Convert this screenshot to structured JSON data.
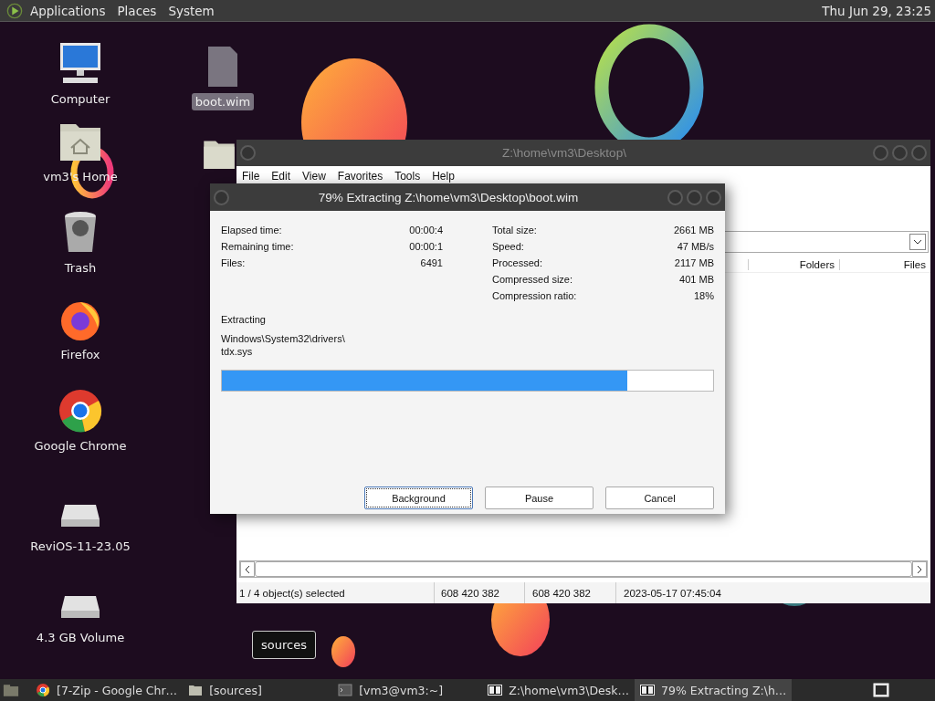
{
  "top_panel": {
    "menus": [
      "Applications",
      "Places",
      "System"
    ],
    "clock": "Thu Jun 29, 23:25"
  },
  "desktop_icons": [
    {
      "kind": "computer",
      "label": "Computer",
      "selected": false,
      "focused": false
    },
    {
      "kind": "home",
      "label": "vm3's Home",
      "selected": false,
      "focused": false
    },
    {
      "kind": "trash",
      "label": "Trash",
      "selected": false,
      "focused": false
    },
    {
      "kind": "firefox",
      "label": "Firefox",
      "selected": false,
      "focused": false
    },
    {
      "kind": "chrome",
      "label": "Google Chrome",
      "selected": false,
      "focused": false
    },
    {
      "kind": "drive",
      "label": "ReviOS-11-23.05",
      "selected": false,
      "focused": false
    },
    {
      "kind": "drive",
      "label": "4.3 GB Volume",
      "selected": false,
      "focused": false
    },
    {
      "kind": "file",
      "label": "boot.wim",
      "selected": true,
      "focused": false
    },
    {
      "kind": "folder"
    },
    {
      "kind": "hidden",
      "label": "sources",
      "selected": false,
      "focused": true
    }
  ],
  "file_manager": {
    "title": "Z:\\home\\vm3\\Desktop\\",
    "active": false,
    "menu": [
      "File",
      "Edit",
      "View",
      "Favorites",
      "Tools",
      "Help"
    ],
    "columns": [
      "Folders",
      "Files"
    ],
    "status_bar": [
      "1 / 4 object(s) selected",
      "608 420 382",
      "608 420 382",
      "2023-05-17 07:45:04"
    ]
  },
  "dialog": {
    "title": "79% Extracting Z:\\home\\vm3\\Desktop\\boot.wim",
    "active": true,
    "stats_left": [
      {
        "label": "Elapsed time:",
        "value": "00:00:4"
      },
      {
        "label": "Remaining time:",
        "value": "00:00:1"
      },
      {
        "label": "Files:",
        "value": "6491"
      }
    ],
    "stats_right": [
      {
        "label": "Total size:",
        "value": "2661 MB"
      },
      {
        "label": "Speed:",
        "value": "47 MB/s"
      },
      {
        "label": "Processed:",
        "value": "2117 MB"
      },
      {
        "label": "Compressed size:",
        "value": "401 MB"
      },
      {
        "label": "Compression ratio:",
        "value": "18%"
      }
    ],
    "operation": "Extracting",
    "current_file": [
      "Windows\\System32\\drivers\\",
      "tdx.sys"
    ],
    "progress": {
      "level": 0.825
    },
    "buttons": [
      {
        "label": "Background",
        "focused": true
      },
      {
        "label": "Pause",
        "focused": false
      },
      {
        "label": "Cancel",
        "focused": false
      }
    ]
  },
  "taskbar": {
    "items": [
      {
        "kind": "chrome",
        "label": "[7-Zip - Google Chr…",
        "selected": false
      },
      {
        "kind": "folder",
        "label": "[sources]",
        "selected": false
      },
      {
        "kind": "terminal",
        "label": "[vm3@vm3:~]",
        "selected": false
      },
      {
        "kind": "sevenzip",
        "label": "Z:\\home\\vm3\\Desk…",
        "selected": false
      },
      {
        "kind": "sevenzip",
        "label": "79% Extracting Z:\\h…",
        "selected": true
      }
    ]
  }
}
